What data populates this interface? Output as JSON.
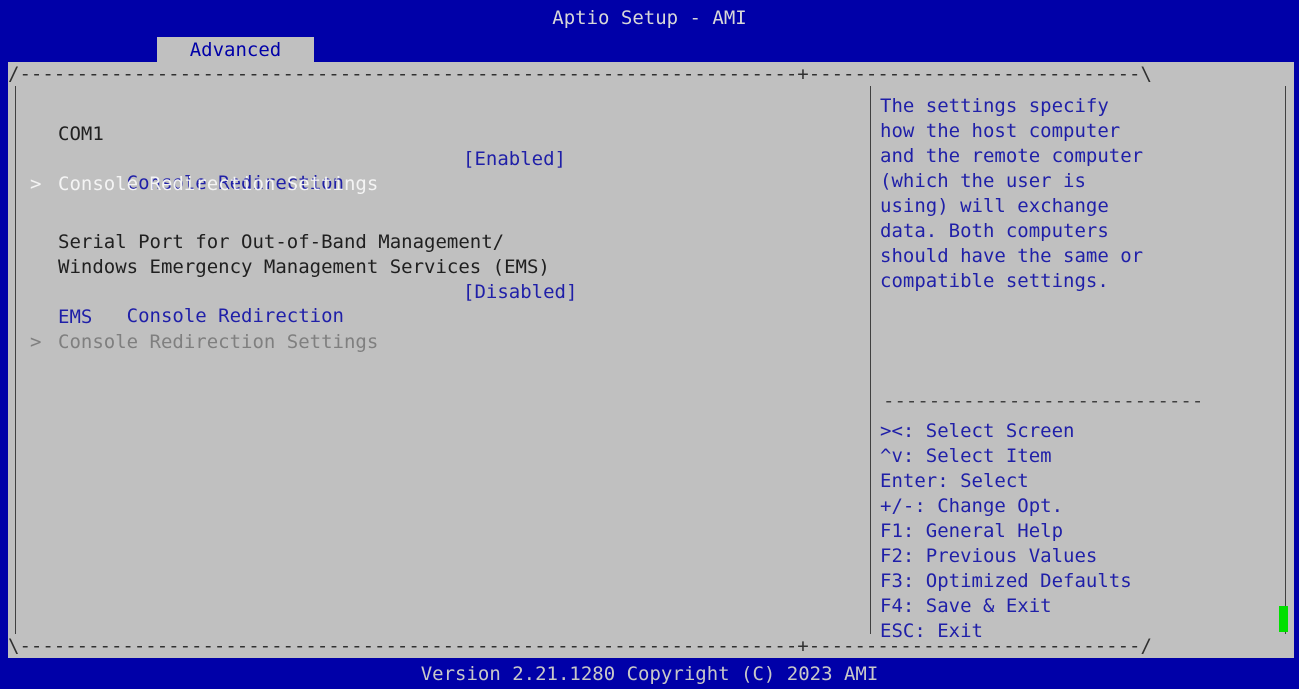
{
  "header": {
    "title": "Aptio Setup - AMI",
    "active_tab": "Advanced"
  },
  "menu": {
    "com1_heading": "COM1",
    "console_redirection_1": {
      "label": "Console Redirection",
      "value": "[Enabled]"
    },
    "console_redirection_settings_1": {
      "prefix": ">",
      "label": "Console Redirection Settings"
    },
    "serial_heading_1": "Serial Port for Out-of-Band Management/",
    "serial_heading_2": "Windows Emergency Management Services (EMS)",
    "console_redirection_2": {
      "label": "Console Redirection",
      "value": "[Disabled]"
    },
    "ems_label": "EMS",
    "console_redirection_settings_2": {
      "prefix": ">",
      "label": "Console Redirection Settings"
    }
  },
  "help": {
    "lines": [
      "The settings specify",
      "how the host computer",
      "and the remote computer",
      "(which the user is",
      "using) will exchange",
      "data. Both computers",
      "should have the same or",
      "compatible settings."
    ]
  },
  "keys": [
    "><: Select Screen",
    "^v: Select Item",
    "Enter: Select",
    "+/-: Change Opt.",
    "F1: General Help",
    "F2: Previous Values",
    "F3: Optimized Defaults",
    "F4: Save & Exit",
    "ESC: Exit"
  ],
  "footer": {
    "version": "Version 2.21.1280 Copyright (C) 2023 AMI"
  },
  "colors": {
    "background_blue": "#0000a8",
    "panel_grey": "#c0c0c0",
    "item_blue": "#1f1fa8",
    "highlight_white": "#f4f4f4",
    "cursor_green": "#00e000"
  }
}
